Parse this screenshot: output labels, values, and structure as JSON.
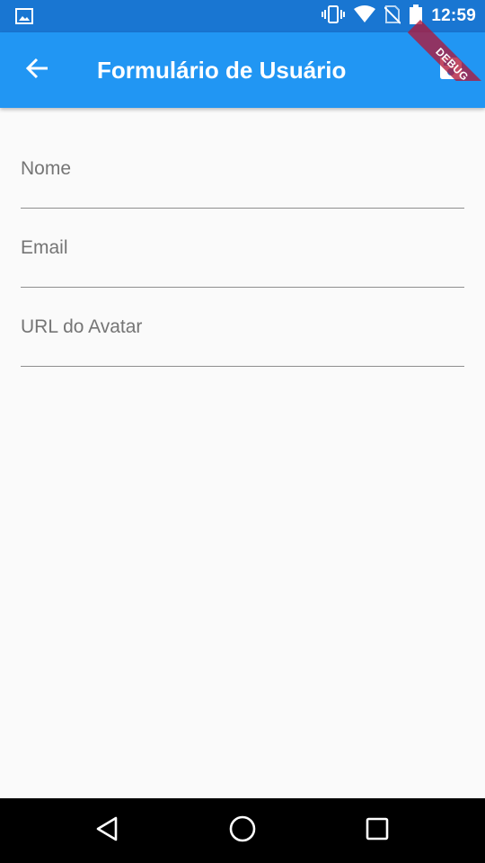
{
  "status_bar": {
    "time": "12:59",
    "icons": [
      "image-icon",
      "vibrate-icon",
      "wifi-icon",
      "no-sim-icon",
      "battery-icon"
    ]
  },
  "app_bar": {
    "title": "Formulário de Usuário",
    "back_icon": "arrow-back-icon",
    "save_icon": "save-icon"
  },
  "debug_banner": {
    "label": "DEBUG"
  },
  "form": {
    "fields": [
      {
        "label": "Nome",
        "value": ""
      },
      {
        "label": "Email",
        "value": ""
      },
      {
        "label": "URL do Avatar",
        "value": ""
      }
    ]
  },
  "nav_bar": {
    "icons": [
      "back-triangle-icon",
      "home-circle-icon",
      "recents-square-icon"
    ]
  },
  "colors": {
    "status_bar": "#1976d2",
    "app_bar": "#2196f3",
    "background": "#fafafa",
    "debug_banner": "#b0183a",
    "label": "#757575",
    "underline": "#8f8f8f"
  }
}
